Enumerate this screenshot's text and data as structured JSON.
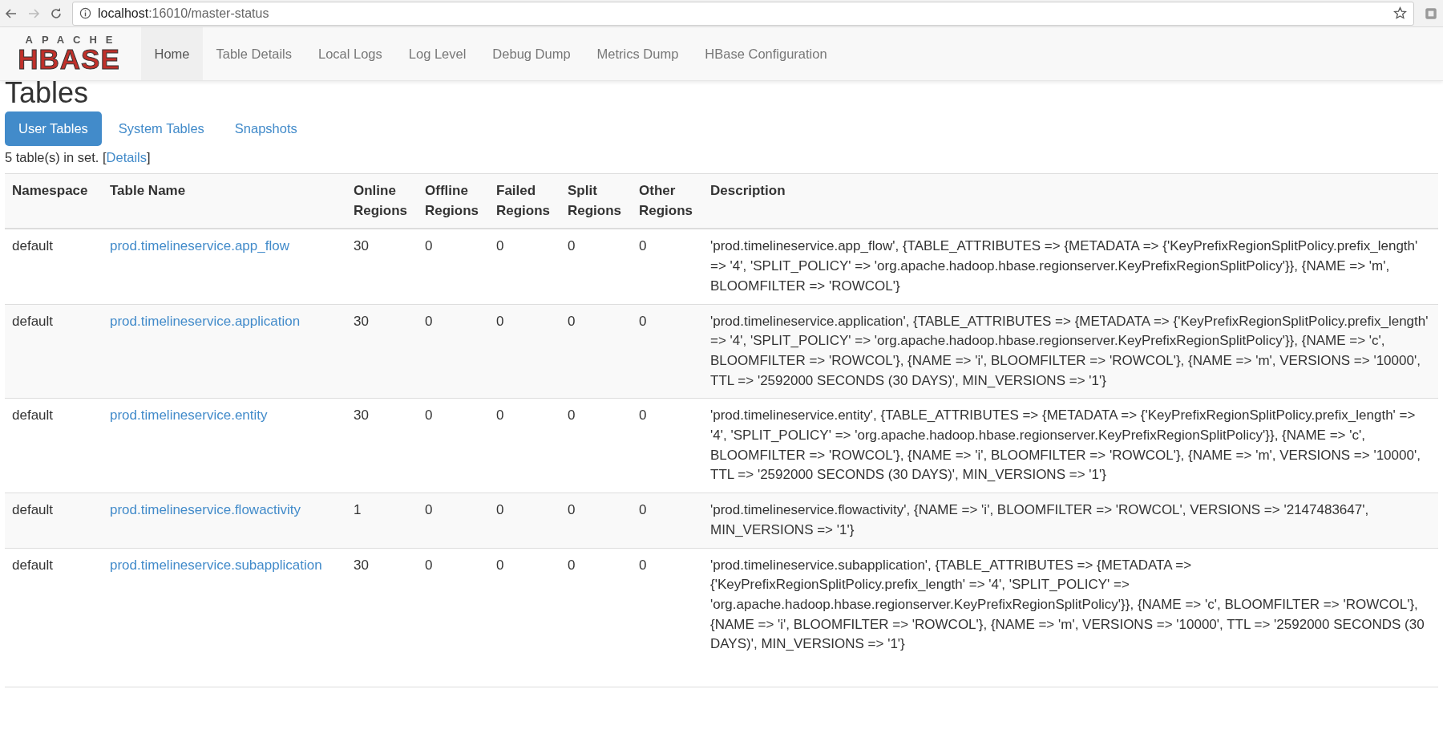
{
  "browser": {
    "url_host": "localhost",
    "url_path": ":16010/master-status"
  },
  "logo": {
    "top": "APACHE",
    "bottom": "HBASE"
  },
  "nav": [
    {
      "label": "Home",
      "selected": true
    },
    {
      "label": "Table Details",
      "selected": false
    },
    {
      "label": "Local Logs",
      "selected": false
    },
    {
      "label": "Log Level",
      "selected": false
    },
    {
      "label": "Debug Dump",
      "selected": false
    },
    {
      "label": "Metrics Dump",
      "selected": false
    },
    {
      "label": "HBase Configuration",
      "selected": false
    }
  ],
  "heading": "Tables",
  "tabs": [
    {
      "label": "User Tables",
      "selected": true
    },
    {
      "label": "System Tables",
      "selected": false
    },
    {
      "label": "Snapshots",
      "selected": false
    }
  ],
  "summary": {
    "text": "5 table(s) in set. [",
    "link": "Details",
    "close": "]"
  },
  "table": {
    "columns": [
      [
        "Namespace"
      ],
      [
        "Table Name"
      ],
      [
        "Online",
        "Regions"
      ],
      [
        "Offline",
        "Regions"
      ],
      [
        "Failed",
        "Regions"
      ],
      [
        "Split",
        "Regions"
      ],
      [
        "Other",
        "Regions"
      ],
      [
        "Description"
      ]
    ],
    "rows": [
      {
        "namespace": "default",
        "name": "prod.timelineservice.app_flow",
        "online": "30",
        "offline": "0",
        "failed": "0",
        "split": "0",
        "other": "0",
        "description": "'prod.timelineservice.app_flow', {TABLE_ATTRIBUTES => {METADATA => {'KeyPrefixRegionSplitPolicy.prefix_length' => '4', 'SPLIT_POLICY' => 'org.apache.hadoop.hbase.regionserver.KeyPrefixRegionSplitPolicy'}}, {NAME => 'm', BLOOMFILTER => 'ROWCOL'}"
      },
      {
        "namespace": "default",
        "name": "prod.timelineservice.application",
        "online": "30",
        "offline": "0",
        "failed": "0",
        "split": "0",
        "other": "0",
        "description": "'prod.timelineservice.application', {TABLE_ATTRIBUTES => {METADATA => {'KeyPrefixRegionSplitPolicy.prefix_length' => '4', 'SPLIT_POLICY' => 'org.apache.hadoop.hbase.regionserver.KeyPrefixRegionSplitPolicy'}}, {NAME => 'c', BLOOMFILTER => 'ROWCOL'}, {NAME => 'i', BLOOMFILTER => 'ROWCOL'}, {NAME => 'm', VERSIONS => '10000', TTL => '2592000 SECONDS (30 DAYS)', MIN_VERSIONS => '1'}"
      },
      {
        "namespace": "default",
        "name": "prod.timelineservice.entity",
        "online": "30",
        "offline": "0",
        "failed": "0",
        "split": "0",
        "other": "0",
        "description": "'prod.timelineservice.entity', {TABLE_ATTRIBUTES => {METADATA => {'KeyPrefixRegionSplitPolicy.prefix_length' => '4', 'SPLIT_POLICY' => 'org.apache.hadoop.hbase.regionserver.KeyPrefixRegionSplitPolicy'}}, {NAME => 'c', BLOOMFILTER => 'ROWCOL'}, {NAME => 'i', BLOOMFILTER => 'ROWCOL'}, {NAME => 'm', VERSIONS => '10000', TTL => '2592000 SECONDS (30 DAYS)', MIN_VERSIONS => '1'}"
      },
      {
        "namespace": "default",
        "name": "prod.timelineservice.flowactivity",
        "online": "1",
        "offline": "0",
        "failed": "0",
        "split": "0",
        "other": "0",
        "description": "'prod.timelineservice.flowactivity', {NAME => 'i', BLOOMFILTER => 'ROWCOL', VERSIONS => '2147483647', MIN_VERSIONS => '1'}"
      },
      {
        "namespace": "default",
        "name": "prod.timelineservice.subapplication",
        "online": "30",
        "offline": "0",
        "failed": "0",
        "split": "0",
        "other": "0",
        "description": "'prod.timelineservice.subapplication', {TABLE_ATTRIBUTES => {METADATA => {'KeyPrefixRegionSplitPolicy.prefix_length' => '4', 'SPLIT_POLICY' => 'org.apache.hadoop.hbase.regionserver.KeyPrefixRegionSplitPolicy'}}, {NAME => 'c', BLOOMFILTER => 'ROWCOL'}, {NAME => 'i', BLOOMFILTER => 'ROWCOL'}, {NAME => 'm', VERSIONS => '10000', TTL => '2592000 SECONDS (30 DAYS)', MIN_VERSIONS => '1'}"
      }
    ]
  }
}
